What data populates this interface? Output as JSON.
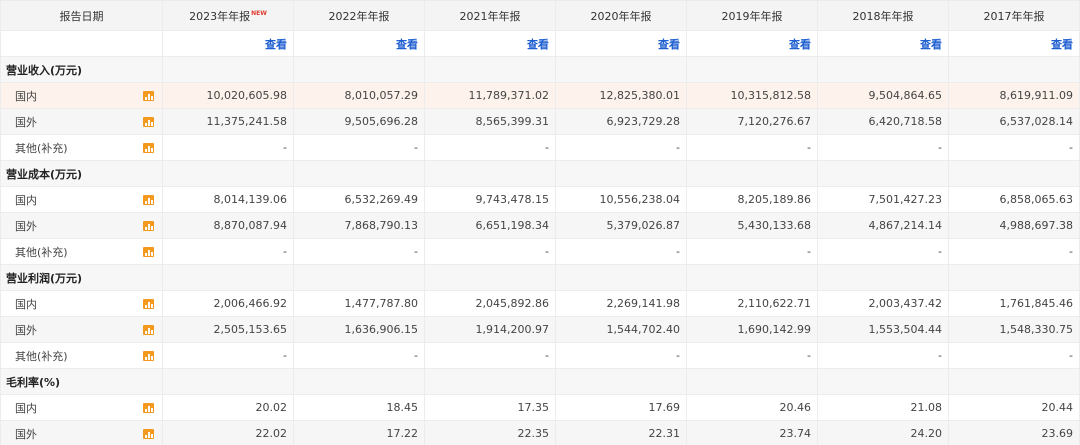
{
  "header": {
    "label": "报告日期",
    "new_badge": "NEW",
    "years": [
      "2023年年报",
      "2022年年报",
      "2021年年报",
      "2020年年报",
      "2019年年报",
      "2018年年报",
      "2017年年报"
    ],
    "view_label": "查看"
  },
  "sections": [
    {
      "title": "营业收入(万元)",
      "rows": [
        {
          "label": "国内",
          "values": [
            "10,020,605.98",
            "8,010,057.29",
            "11,789,371.02",
            "12,825,380.01",
            "10,315,812.58",
            "9,504,864.65",
            "8,619,911.09"
          ]
        },
        {
          "label": "国外",
          "values": [
            "11,375,241.58",
            "9,505,696.28",
            "8,565,399.31",
            "6,923,729.28",
            "7,120,276.67",
            "6,420,718.58",
            "6,537,028.14"
          ]
        },
        {
          "label": "其他(补充)",
          "values": [
            "-",
            "-",
            "-",
            "-",
            "-",
            "-",
            "-"
          ]
        }
      ]
    },
    {
      "title": "营业成本(万元)",
      "rows": [
        {
          "label": "国内",
          "values": [
            "8,014,139.06",
            "6,532,269.49",
            "9,743,478.15",
            "10,556,238.04",
            "8,205,189.86",
            "7,501,427.23",
            "6,858,065.63"
          ]
        },
        {
          "label": "国外",
          "values": [
            "8,870,087.94",
            "7,868,790.13",
            "6,651,198.34",
            "5,379,026.87",
            "5,430,133.68",
            "4,867,214.14",
            "4,988,697.38"
          ]
        },
        {
          "label": "其他(补充)",
          "values": [
            "-",
            "-",
            "-",
            "-",
            "-",
            "-",
            "-"
          ]
        }
      ]
    },
    {
      "title": "营业利润(万元)",
      "rows": [
        {
          "label": "国内",
          "values": [
            "2,006,466.92",
            "1,477,787.80",
            "2,045,892.86",
            "2,269,141.98",
            "2,110,622.71",
            "2,003,437.42",
            "1,761,845.46"
          ]
        },
        {
          "label": "国外",
          "values": [
            "2,505,153.65",
            "1,636,906.15",
            "1,914,200.97",
            "1,544,702.40",
            "1,690,142.99",
            "1,553,504.44",
            "1,548,330.75"
          ]
        },
        {
          "label": "其他(补充)",
          "values": [
            "-",
            "-",
            "-",
            "-",
            "-",
            "-",
            "-"
          ]
        }
      ]
    },
    {
      "title": "毛利率(%)",
      "rows": [
        {
          "label": "国内",
          "values": [
            "20.02",
            "18.45",
            "17.35",
            "17.69",
            "20.46",
            "21.08",
            "20.44"
          ]
        },
        {
          "label": "国外",
          "values": [
            "22.02",
            "17.22",
            "22.35",
            "22.31",
            "23.74",
            "24.20",
            "23.69"
          ]
        }
      ]
    }
  ]
}
